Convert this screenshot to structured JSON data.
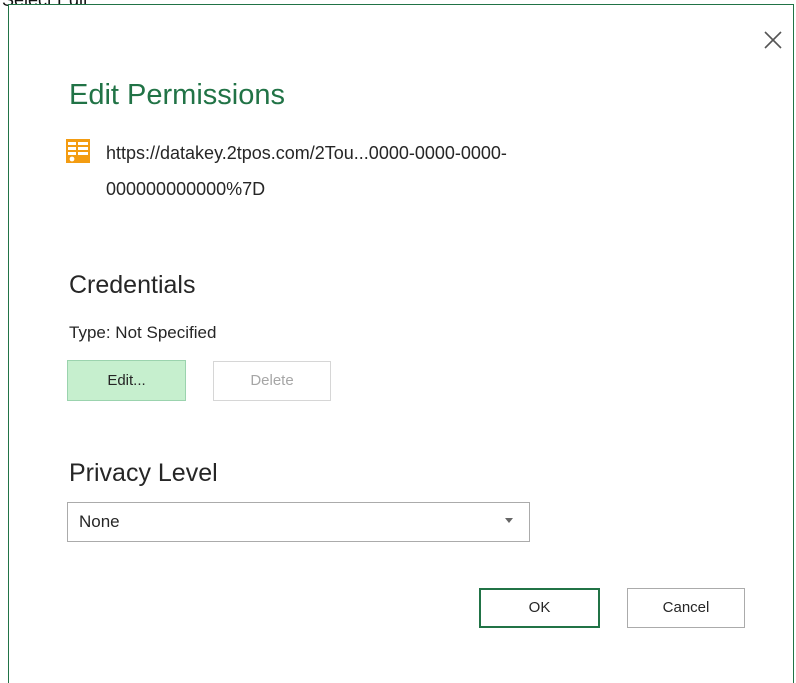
{
  "caption": "Select Edit",
  "dialog": {
    "title": "Edit Permissions",
    "close_icon": "close-icon",
    "source": {
      "icon": "table-icon",
      "url_line1": "https://datakey.2tpos.com/2Tou...0000-0000-0000-",
      "url_line2": "000000000000%7D"
    },
    "credentials": {
      "heading": "Credentials",
      "type_label": "Type: Not Specified",
      "edit_label": "Edit...",
      "delete_label": "Delete"
    },
    "privacy": {
      "heading": "Privacy Level",
      "selected": "None"
    },
    "ok_label": "OK",
    "cancel_label": "Cancel"
  },
  "colors": {
    "accent": "#217346",
    "edit_fill": "#c6efce",
    "icon_orange": "#f39c12"
  }
}
